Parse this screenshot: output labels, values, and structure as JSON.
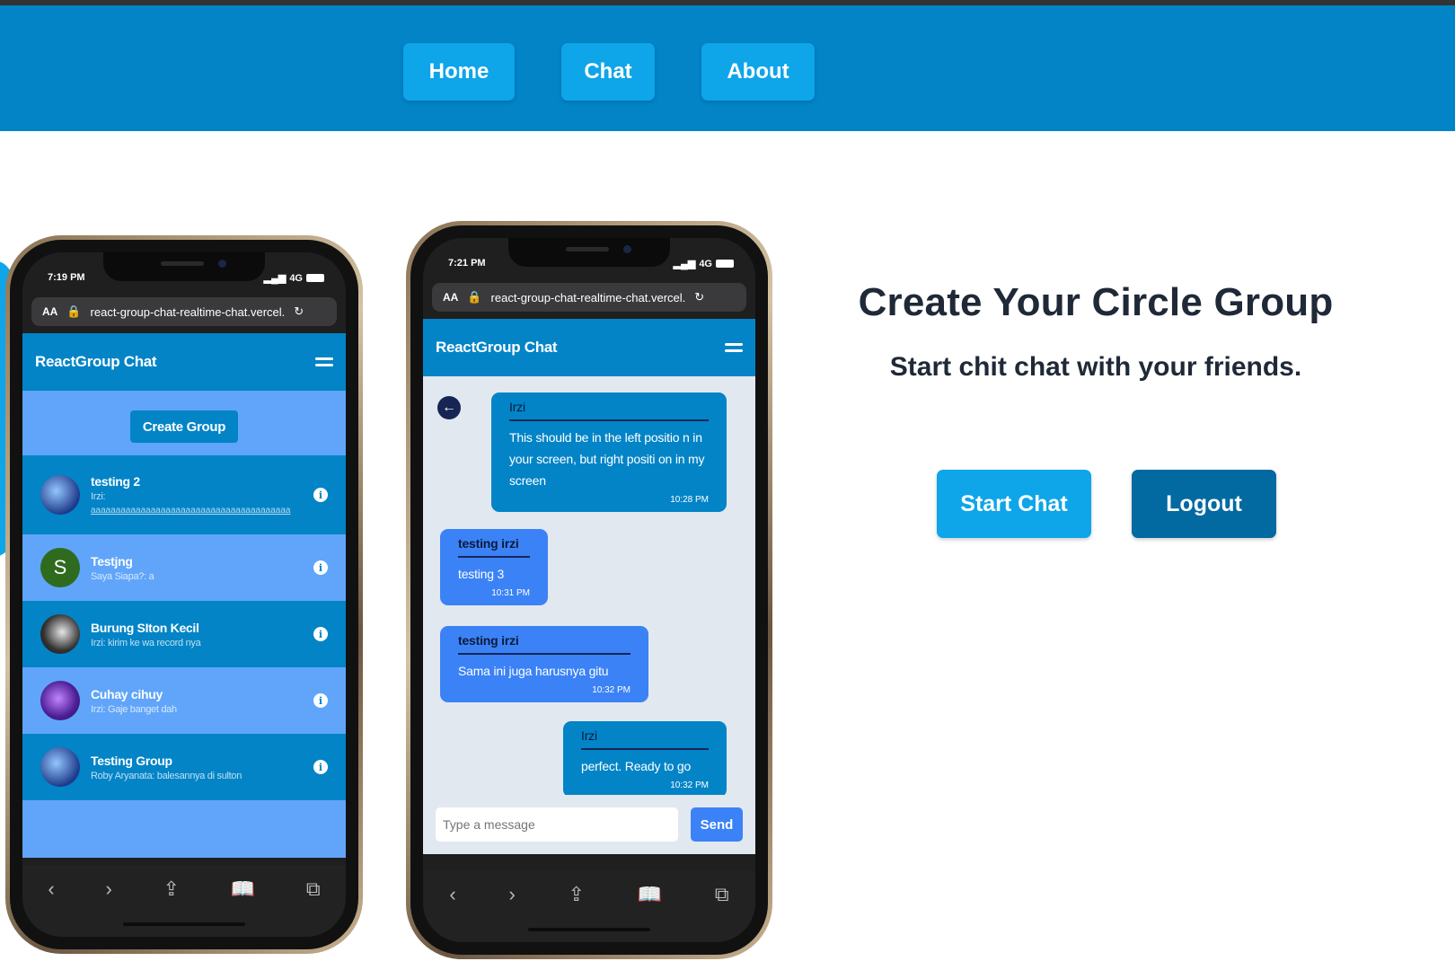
{
  "nav": {
    "home": "Home",
    "chat": "Chat",
    "about": "About"
  },
  "hero": {
    "title": "Create Your Circle Group",
    "subtitle": "Start chit chat with your friends.",
    "start_chat": "Start Chat",
    "logout": "Logout"
  },
  "phone1": {
    "time": "7:19 PM",
    "signal": "4G",
    "aa": "AA",
    "url": "react-group-chat-realtime-chat.vercel.",
    "app_title": "ReactGroup Chat",
    "create_group": "Create Group",
    "groups": [
      {
        "name": "testing 2",
        "last": "Irzi:",
        "extra": "aaaaaaaaaaaaaaaaaaaaaaaaaaaaaaaaaaaaaaaa"
      },
      {
        "name": "Testjng",
        "last": "Saya Siapa?: a",
        "avatar_letter": "S"
      },
      {
        "name": "Burung SIton Kecil",
        "last": "Irzi: kirim ke wa record nya"
      },
      {
        "name": "Cuhay cihuy",
        "last": "Irzi: Gaje banget dah"
      },
      {
        "name": "Testing Group",
        "last": "Roby Aryanata: balesannya di sulton"
      }
    ]
  },
  "phone2": {
    "time": "7:21 PM",
    "signal": "4G",
    "aa": "AA",
    "url": "react-group-chat-realtime-chat.vercel.",
    "app_title": "ReactGroup Chat",
    "messages": [
      {
        "sender": "Irzi",
        "text": "This should be in the left positio n in your screen, but right positi on in my screen",
        "time": "10:28 PM"
      },
      {
        "sender": "testing irzi",
        "text": "testing 3",
        "time": "10:31 PM"
      },
      {
        "sender": "testing irzi",
        "text": "Sama ini juga harusnya gitu",
        "time": "10:32 PM"
      },
      {
        "sender": "Irzi",
        "text": "perfect. Ready to go",
        "time": "10:32 PM"
      }
    ],
    "input_placeholder": "Type a message",
    "send": "Send"
  },
  "browser_toolbar": {
    "back": "‹",
    "forward": "›",
    "share": "⇪",
    "bookmarks": "📖",
    "tabs": "⧉"
  },
  "colors": {
    "nav_bg": "#0284c7",
    "button": "#0ea5e9",
    "logout": "#0369a1",
    "group_list_bg": "#60a5fa"
  }
}
